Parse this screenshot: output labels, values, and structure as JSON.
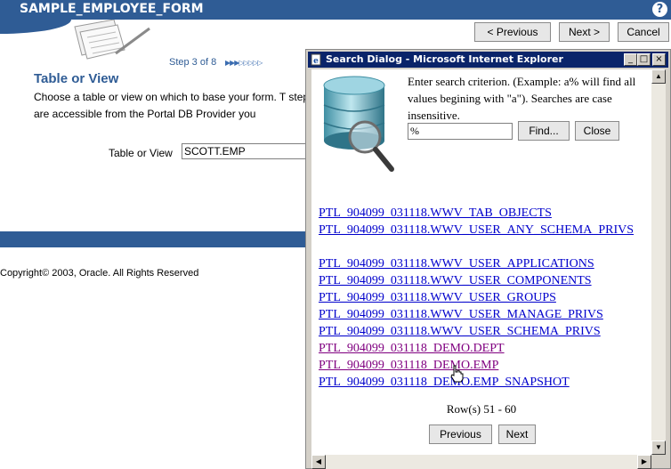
{
  "app": {
    "title": "SAMPLE_EMPLOYEE_FORM",
    "help_icon": "?"
  },
  "wizard": {
    "step": "Step 3 of 8",
    "step_arrows": "▶▶▶▷▷▷▷▷",
    "buttons": {
      "previous": "< Previous",
      "next": "Next >",
      "cancel": "Cancel"
    },
    "heading": "Table or View",
    "description": "Choose a table or view on which to base your form. T step are accessible from the Portal DB Provider you",
    "field_label": "Table or View",
    "field_value": "SCOTT.EMP",
    "copyright": "Copyright© 2003, Oracle. All Rights Reserved"
  },
  "dialog": {
    "title": "Search Dialog - Microsoft Internet Explorer",
    "controls": {
      "minimize": "_",
      "maximize": "□",
      "close": "×"
    },
    "instructions": "Enter search criterion. (Example: a% will find all values begining with \"a\"). Searches are case insensitive.",
    "search_value": "%",
    "find_label": "Find...",
    "close_label": "Close",
    "results": [
      {
        "text": "PTL_904099_031118.WWV_TAB_OBJECTS",
        "visited": false
      },
      {
        "text": "PTL_904099_031118.WWV_USER_ANY_SCHEMA_PRIVS",
        "visited": false
      },
      {
        "text": "PTL_904099_031118.WWV_USER_APPLICATIONS",
        "visited": false
      },
      {
        "text": "PTL_904099_031118.WWV_USER_COMPONENTS",
        "visited": false
      },
      {
        "text": "PTL_904099_031118.WWV_USER_GROUPS",
        "visited": false
      },
      {
        "text": "PTL_904099_031118.WWV_USER_MANAGE_PRIVS",
        "visited": false
      },
      {
        "text": "PTL_904099_031118.WWV_USER_SCHEMA_PRIVS",
        "visited": false
      },
      {
        "text": "PTL_904099_031118_DEMO.DEPT",
        "visited": true
      },
      {
        "text": "PTL_904099_031118_DEMO.EMP",
        "visited": true
      },
      {
        "text": "PTL_904099_031118_DEMO.EMP_SNAPSHOT",
        "visited": false
      }
    ],
    "rows_label": "Row(s) 51 - 60",
    "previous_label": "Previous",
    "next_label": "Next"
  },
  "colors": {
    "brand": "#2f5c95",
    "link": "#0000cc",
    "visited": "#800080",
    "titlebar": "#0a246a"
  }
}
